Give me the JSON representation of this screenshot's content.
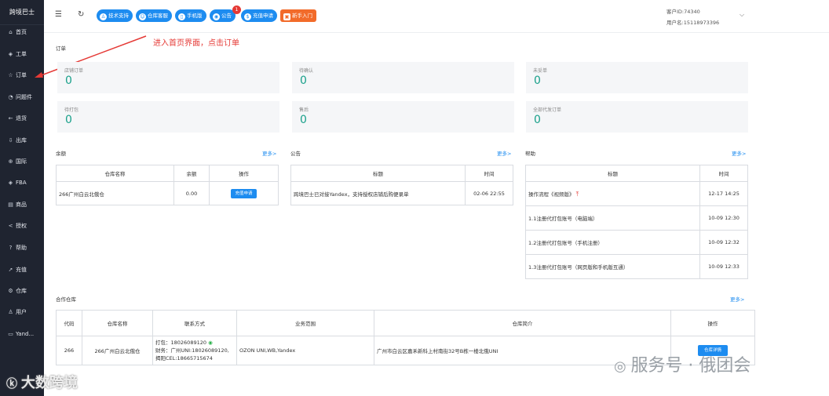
{
  "sidebar": {
    "brand": "跨境巴士",
    "items": [
      {
        "label": "首页",
        "icon": "home-icon",
        "glyph": "⌂"
      },
      {
        "label": "工单",
        "icon": "ticket-icon",
        "glyph": "◈"
      },
      {
        "label": "订单",
        "icon": "star-icon",
        "glyph": "☆"
      },
      {
        "label": "问题件",
        "icon": "alert-icon",
        "glyph": "◔"
      },
      {
        "label": "退货",
        "icon": "return-icon",
        "glyph": "←"
      },
      {
        "label": "出库",
        "icon": "outbound-icon",
        "glyph": "⇩"
      },
      {
        "label": "国际",
        "icon": "globe-icon",
        "glyph": "⊕"
      },
      {
        "label": "FBA",
        "icon": "fba-icon",
        "glyph": "◈"
      },
      {
        "label": "商品",
        "icon": "goods-icon",
        "glyph": "▤"
      },
      {
        "label": "授权",
        "icon": "share-icon",
        "glyph": "<"
      },
      {
        "label": "帮助",
        "icon": "help-icon",
        "glyph": "?"
      },
      {
        "label": "充值",
        "icon": "send-icon",
        "glyph": "➚"
      },
      {
        "label": "仓库",
        "icon": "warehouse-icon",
        "glyph": "⚙"
      },
      {
        "label": "用户",
        "icon": "user-icon",
        "glyph": "♙"
      },
      {
        "label": "Yand...",
        "icon": "yandex-icon",
        "glyph": "▭"
      }
    ]
  },
  "topbar": {
    "menu_glyph": "☰",
    "refresh_glyph": "↻",
    "buttons": [
      {
        "label": "技术支持",
        "icon": "support-icon",
        "glyph": "♙"
      },
      {
        "label": "仓库客服",
        "icon": "service-icon",
        "glyph": "☺"
      },
      {
        "label": "手机版",
        "icon": "phone-icon",
        "glyph": "▯"
      },
      {
        "label": "公告",
        "icon": "notice-icon",
        "glyph": "◉"
      },
      {
        "label": "充值申请",
        "icon": "recharge-icon",
        "glyph": "$"
      },
      {
        "label": "新手入门",
        "icon": "beginner-icon",
        "glyph": "▣"
      }
    ],
    "notice_badge": "1",
    "customer_id": "客户ID:74340",
    "username": "用户名:15118973396",
    "chevron": "⌵"
  },
  "annotation": "进入首页界面，点击订单",
  "orders": {
    "title": "订单",
    "stats": [
      {
        "label": "店铺订单",
        "value": "0"
      },
      {
        "label": "待确认",
        "value": "0"
      },
      {
        "label": "未妥单",
        "value": "0"
      },
      {
        "label": "待打包",
        "value": "0"
      },
      {
        "label": "售后",
        "value": "0"
      },
      {
        "label": "全部代发订单",
        "value": "0"
      }
    ]
  },
  "balance": {
    "title": "余额",
    "more": "更多>",
    "headers": [
      "仓库名称",
      "余额",
      "操作"
    ],
    "rows": [
      {
        "name": "266广州白云北俄仓",
        "amount": "0.00",
        "action": "充值申请"
      }
    ]
  },
  "notice": {
    "title": "公告",
    "more": "更多>",
    "headers": [
      "标题",
      "时间"
    ],
    "rows": [
      {
        "title": "跨境巴士已对接Yandex，支持授权店铺后购便录单",
        "time": "02-06 22:55"
      }
    ]
  },
  "help": {
    "title": "帮助",
    "more": "更多>",
    "headers": [
      "标题",
      "时间"
    ],
    "rows": [
      {
        "title": "操作流程《视频版》",
        "time": "12-17 14:25",
        "hot": true
      },
      {
        "title": "1.1注册代打包账号（电脑端）",
        "time": "10-09 12:30"
      },
      {
        "title": "1.2注册代打包账号（手机注册）",
        "time": "10-09 12:32"
      },
      {
        "title": "1.3注册代打包账号（网页版和手机版互通）",
        "time": "10-09 12:33"
      }
    ]
  },
  "partner": {
    "title": "合作仓库",
    "more": "更多>",
    "headers": [
      "代码",
      "仓库名称",
      "联系方式",
      "业务范围",
      "仓库简介",
      "操作"
    ],
    "rows": [
      {
        "code": "266",
        "name": "266广州白云北俄仓",
        "contact_1": "打包：18026089120",
        "contact_2": "财务：广州UNI:18026089120,",
        "contact_3": "揭阳CEL:18665715674",
        "scope": "OZON UNI,WB,Yandex",
        "intro": "广州市白云区嘉禾新科上村南街32号B栋一楼北俄UNI",
        "action": "仓库详情"
      }
    ]
  },
  "watermarks": {
    "left": "大数跨境",
    "right": "服务号 · 俄团会"
  }
}
